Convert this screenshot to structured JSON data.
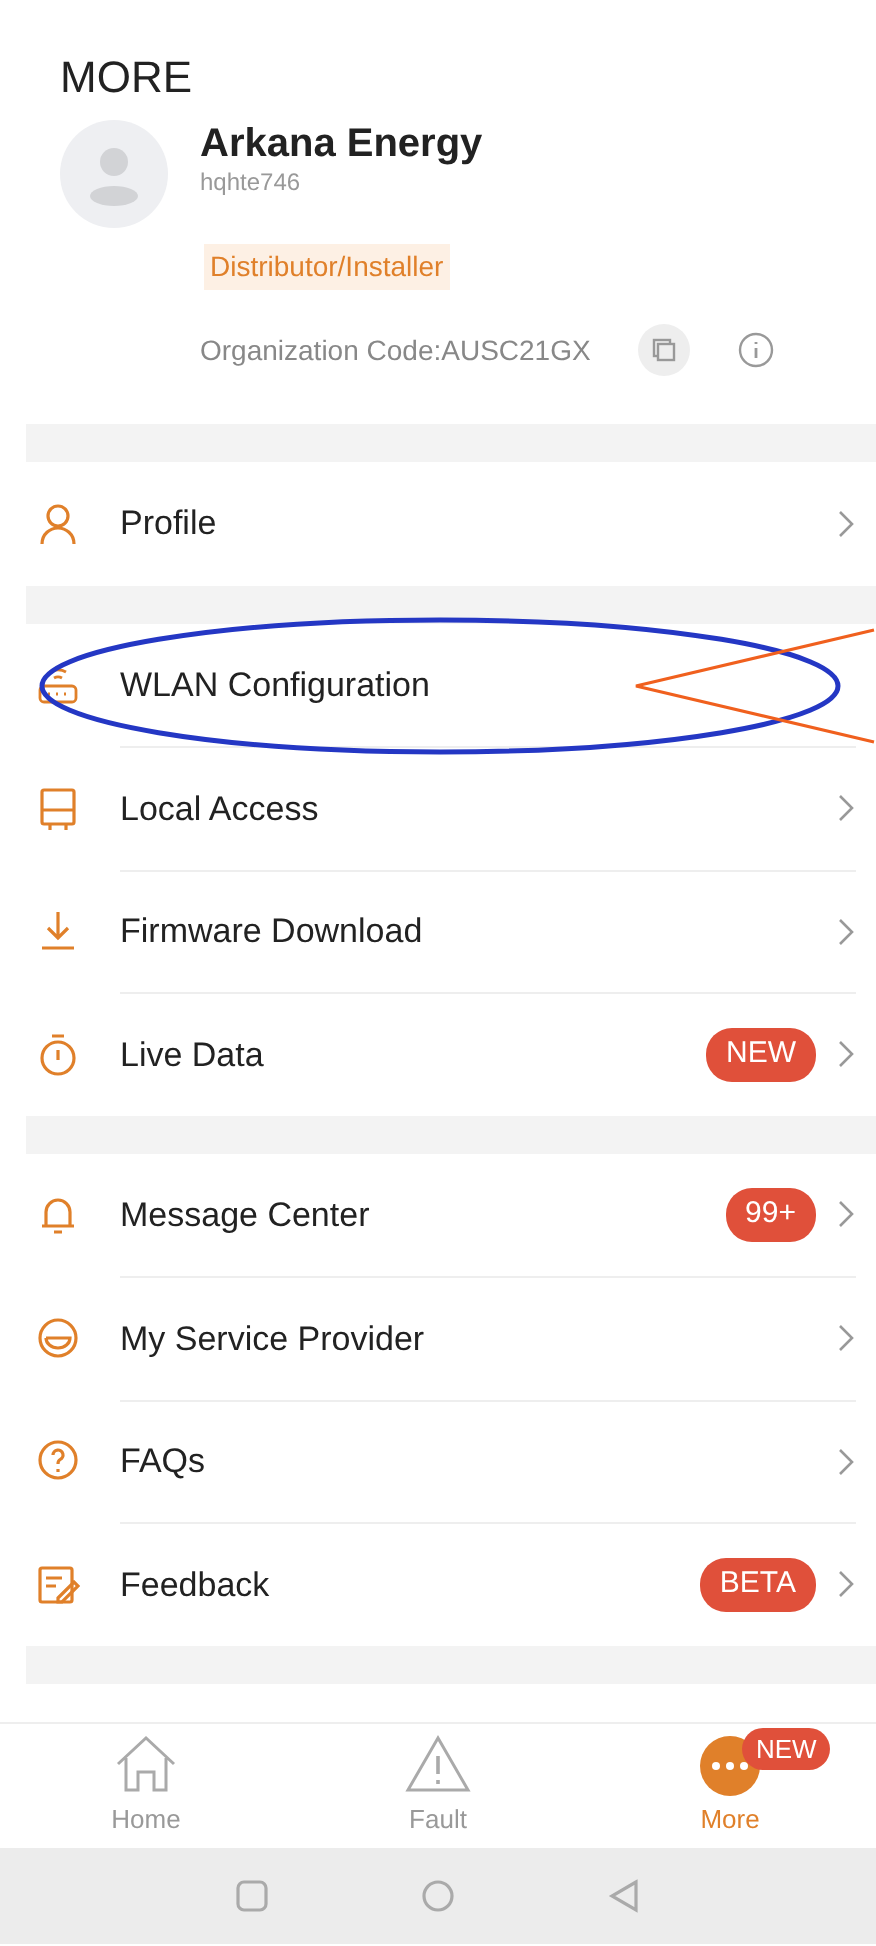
{
  "header": {
    "title": "MORE"
  },
  "account": {
    "name": "Arkana Energy",
    "username": "hqhte746",
    "role": "Distributor/Installer",
    "org_code": "Organization Code:AUSC21GX"
  },
  "sections": [
    {
      "items": [
        {
          "kind": "person",
          "label": "Profile",
          "chevron": true
        }
      ]
    },
    {
      "items": [
        {
          "kind": "router",
          "label": "WLAN Configuration",
          "chevron": false
        },
        {
          "kind": "inverter",
          "label": "Local Access",
          "chevron": true
        },
        {
          "kind": "download",
          "label": "Firmware Download",
          "chevron": true
        },
        {
          "kind": "timer",
          "label": "Live Data",
          "badge": "NEW",
          "chevron": true
        }
      ]
    },
    {
      "items": [
        {
          "kind": "bell",
          "label": "Message Center",
          "badge": "99+",
          "chevron": true
        },
        {
          "kind": "support",
          "label": "My Service Provider",
          "chevron": true
        },
        {
          "kind": "faq",
          "label": "FAQs",
          "chevron": true
        },
        {
          "kind": "feedback",
          "label": "Feedback",
          "badge": "BETA",
          "chevron": true
        }
      ]
    }
  ],
  "tabbar": [
    {
      "kind": "home",
      "label": "Home",
      "selected": false
    },
    {
      "kind": "fault",
      "label": "Fault",
      "selected": false
    },
    {
      "kind": "more",
      "label": "More",
      "selected": true,
      "badge": "NEW"
    }
  ],
  "annotations": [
    {
      "kind": "ellipse",
      "color": "#2437c4"
    },
    {
      "kind": "pointer",
      "color": "#f0601e"
    }
  ]
}
